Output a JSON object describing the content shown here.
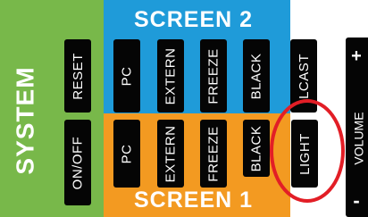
{
  "system": {
    "label": "SYSTEM",
    "reset_label": "RESET",
    "onoff_label": "ON/OFF"
  },
  "screen2": {
    "label": "SCREEN 2",
    "buttons": [
      "PC",
      "EXTERN",
      "FREEZE",
      "BLACK"
    ]
  },
  "screen1": {
    "label": "SCREEN 1",
    "buttons": [
      "PC",
      "EXTERN",
      "FREEZE",
      "BLACK"
    ]
  },
  "right": {
    "cast_label": "LCAST",
    "light_label": "LIGHT",
    "volume_label": "VOLUME",
    "volume_plus": "+",
    "volume_minus": "-"
  },
  "colors": {
    "system": "#78b84a",
    "screen2": "#1f9bd9",
    "screen1": "#f39a21",
    "highlight": "#e21e26"
  }
}
